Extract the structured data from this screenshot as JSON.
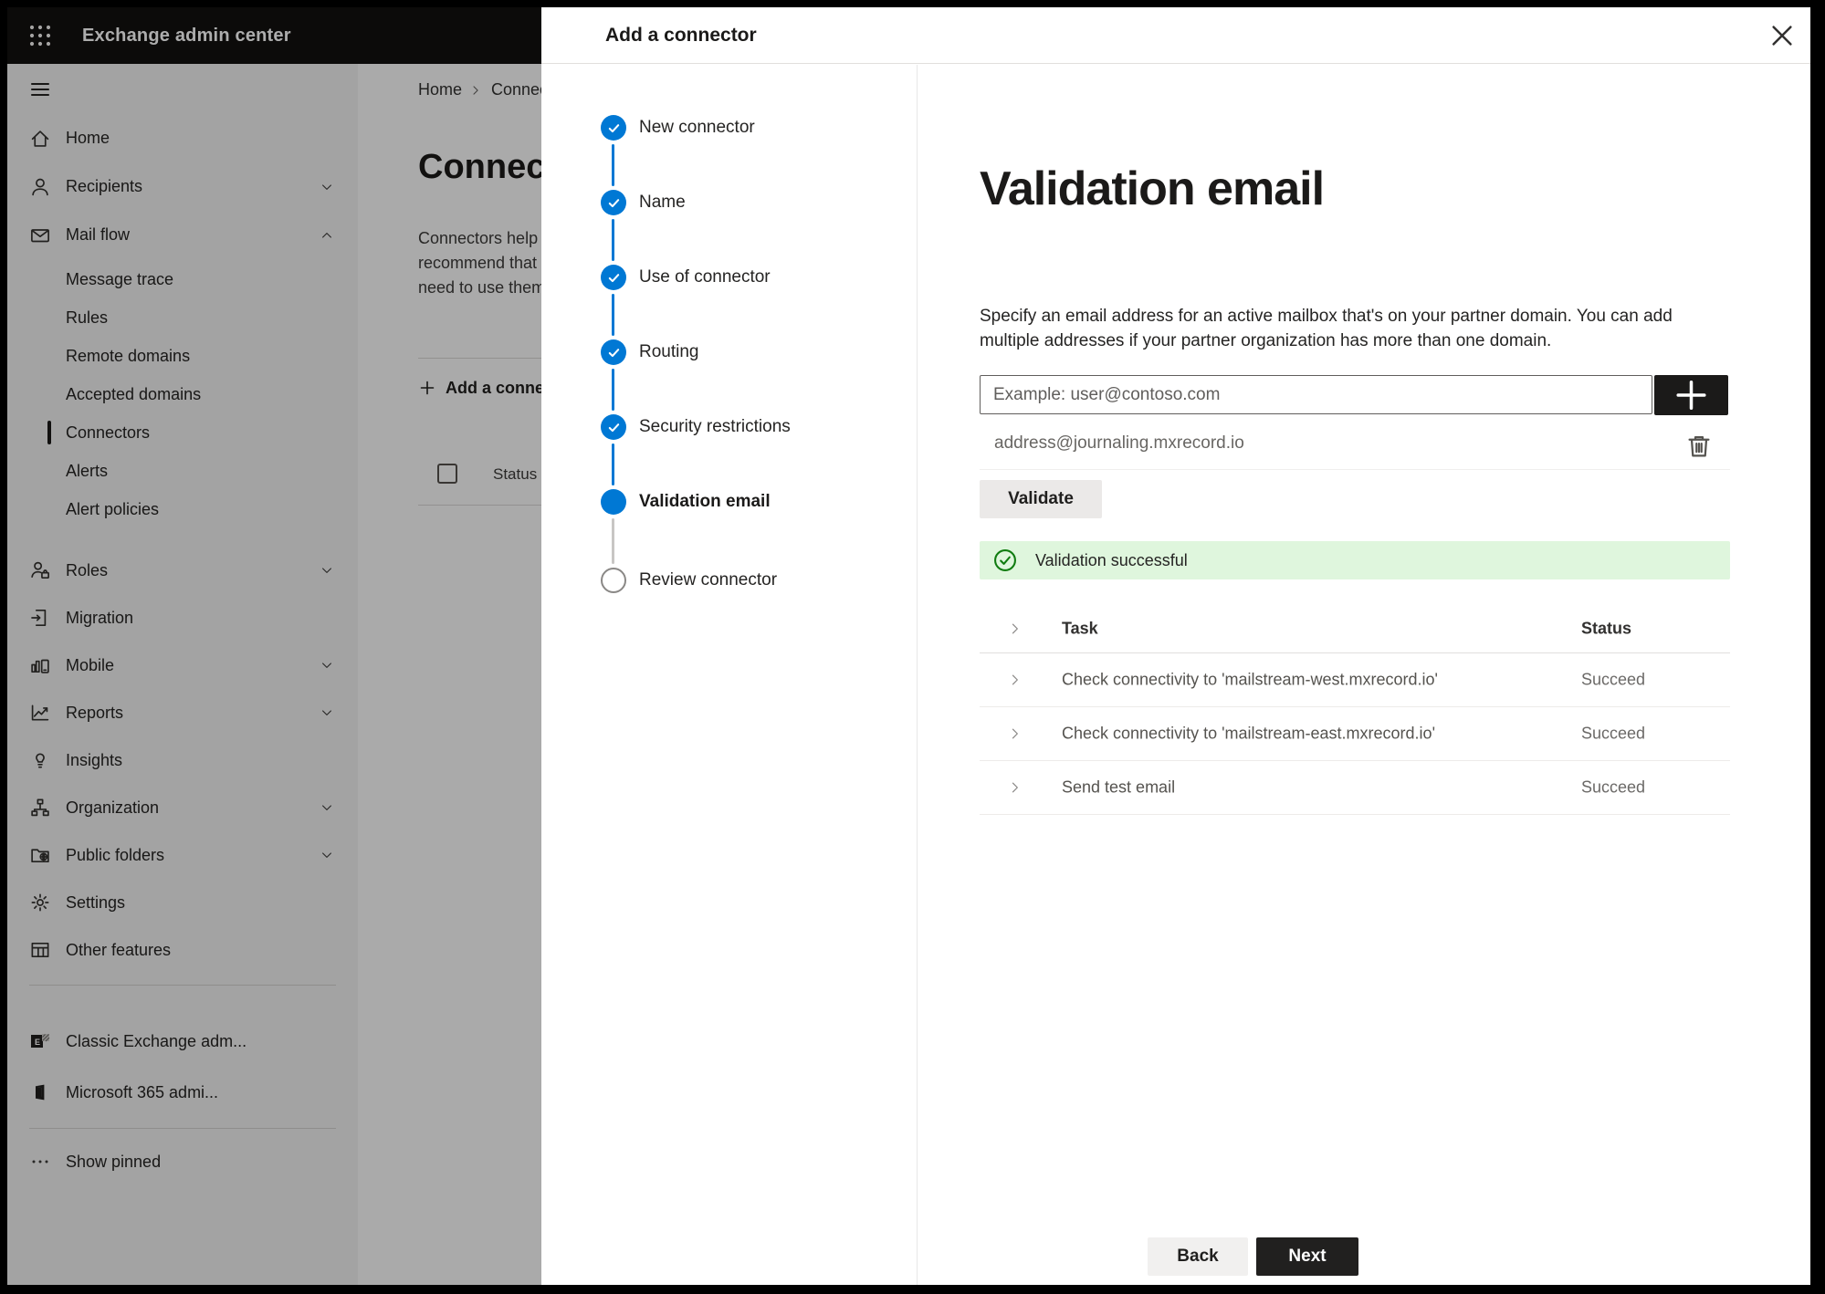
{
  "header": {
    "title": "Exchange admin center"
  },
  "sidebar": {
    "items": [
      {
        "kind": "top",
        "label": "Home",
        "icon": "home-icon"
      },
      {
        "kind": "top",
        "label": "Recipients",
        "icon": "person-icon",
        "chevron": "down"
      },
      {
        "kind": "top",
        "label": "Mail flow",
        "icon": "mail-icon",
        "chevron": "up"
      },
      {
        "kind": "sub",
        "label": "Message trace"
      },
      {
        "kind": "sub",
        "label": "Rules"
      },
      {
        "kind": "sub",
        "label": "Remote domains"
      },
      {
        "kind": "sub",
        "label": "Accepted domains"
      },
      {
        "kind": "sub",
        "label": "Connectors",
        "selected": true
      },
      {
        "kind": "sub",
        "label": "Alerts"
      },
      {
        "kind": "sub",
        "label": "Alert policies"
      },
      {
        "kind": "top",
        "label": "Roles",
        "icon": "roles-icon",
        "chevron": "down"
      },
      {
        "kind": "top",
        "label": "Migration",
        "icon": "migration-icon"
      },
      {
        "kind": "top",
        "label": "Mobile",
        "icon": "mobile-icon",
        "chevron": "down"
      },
      {
        "kind": "top",
        "label": "Reports",
        "icon": "reports-icon",
        "chevron": "down"
      },
      {
        "kind": "top",
        "label": "Insights",
        "icon": "insights-icon"
      },
      {
        "kind": "top",
        "label": "Organization",
        "icon": "organization-icon",
        "chevron": "down"
      },
      {
        "kind": "top",
        "label": "Public folders",
        "icon": "public-folders-icon",
        "chevron": "down"
      },
      {
        "kind": "top",
        "label": "Settings",
        "icon": "settings-icon"
      },
      {
        "kind": "top",
        "label": "Other features",
        "icon": "other-features-icon"
      },
      {
        "kind": "divider"
      },
      {
        "kind": "top",
        "label": "Classic Exchange adm...",
        "icon": "classic-exchange-icon"
      },
      {
        "kind": "top",
        "label": "Microsoft 365 admi...",
        "icon": "m365-icon"
      },
      {
        "kind": "divider"
      },
      {
        "kind": "top",
        "label": "Show pinned",
        "icon": "ellipsis-icon"
      }
    ]
  },
  "background": {
    "breadcrumb": {
      "home": "Home",
      "current": "Connectors"
    },
    "title": "Connectors",
    "description_lines": [
      "Connectors help control the flow of email messages to and",
      "recommend that you first check to see whether you",
      "need to use them for your organization before"
    ],
    "add_button_label": "Add a connector",
    "status_header": "Status"
  },
  "modal": {
    "title": "Add a connector",
    "wizard": {
      "steps": [
        {
          "label": "New connector",
          "state": "done"
        },
        {
          "label": "Name",
          "state": "done"
        },
        {
          "label": "Use of connector",
          "state": "done"
        },
        {
          "label": "Routing",
          "state": "done"
        },
        {
          "label": "Security restrictions",
          "state": "done"
        },
        {
          "label": "Validation email",
          "state": "current"
        },
        {
          "label": "Review connector",
          "state": "upcoming"
        }
      ]
    },
    "content": {
      "heading": "Validation email",
      "description_lines": [
        "Specify an email address for an active mailbox that's on your partner domain. You can add",
        "multiple addresses if your partner organization has more than one domain."
      ],
      "email_placeholder": "Example: user@contoso.com",
      "email_value": "",
      "added_address": "address@journaling.mxrecord.io",
      "validate_label": "Validate",
      "banner_text": "Validation successful",
      "table": {
        "task_header": "Task",
        "status_header": "Status",
        "rows": [
          {
            "task": "Check connectivity to 'mailstream-west.mxrecord.io'",
            "status": "Succeed"
          },
          {
            "task": "Check connectivity to 'mailstream-east.mxrecord.io'",
            "status": "Succeed"
          },
          {
            "task": "Send test email",
            "status": "Succeed"
          }
        ]
      },
      "back_label": "Back",
      "next_label": "Next"
    }
  },
  "colors": {
    "accent": "#0078d4",
    "success_bg": "#dff6dd",
    "success_icon": "#107c10"
  }
}
